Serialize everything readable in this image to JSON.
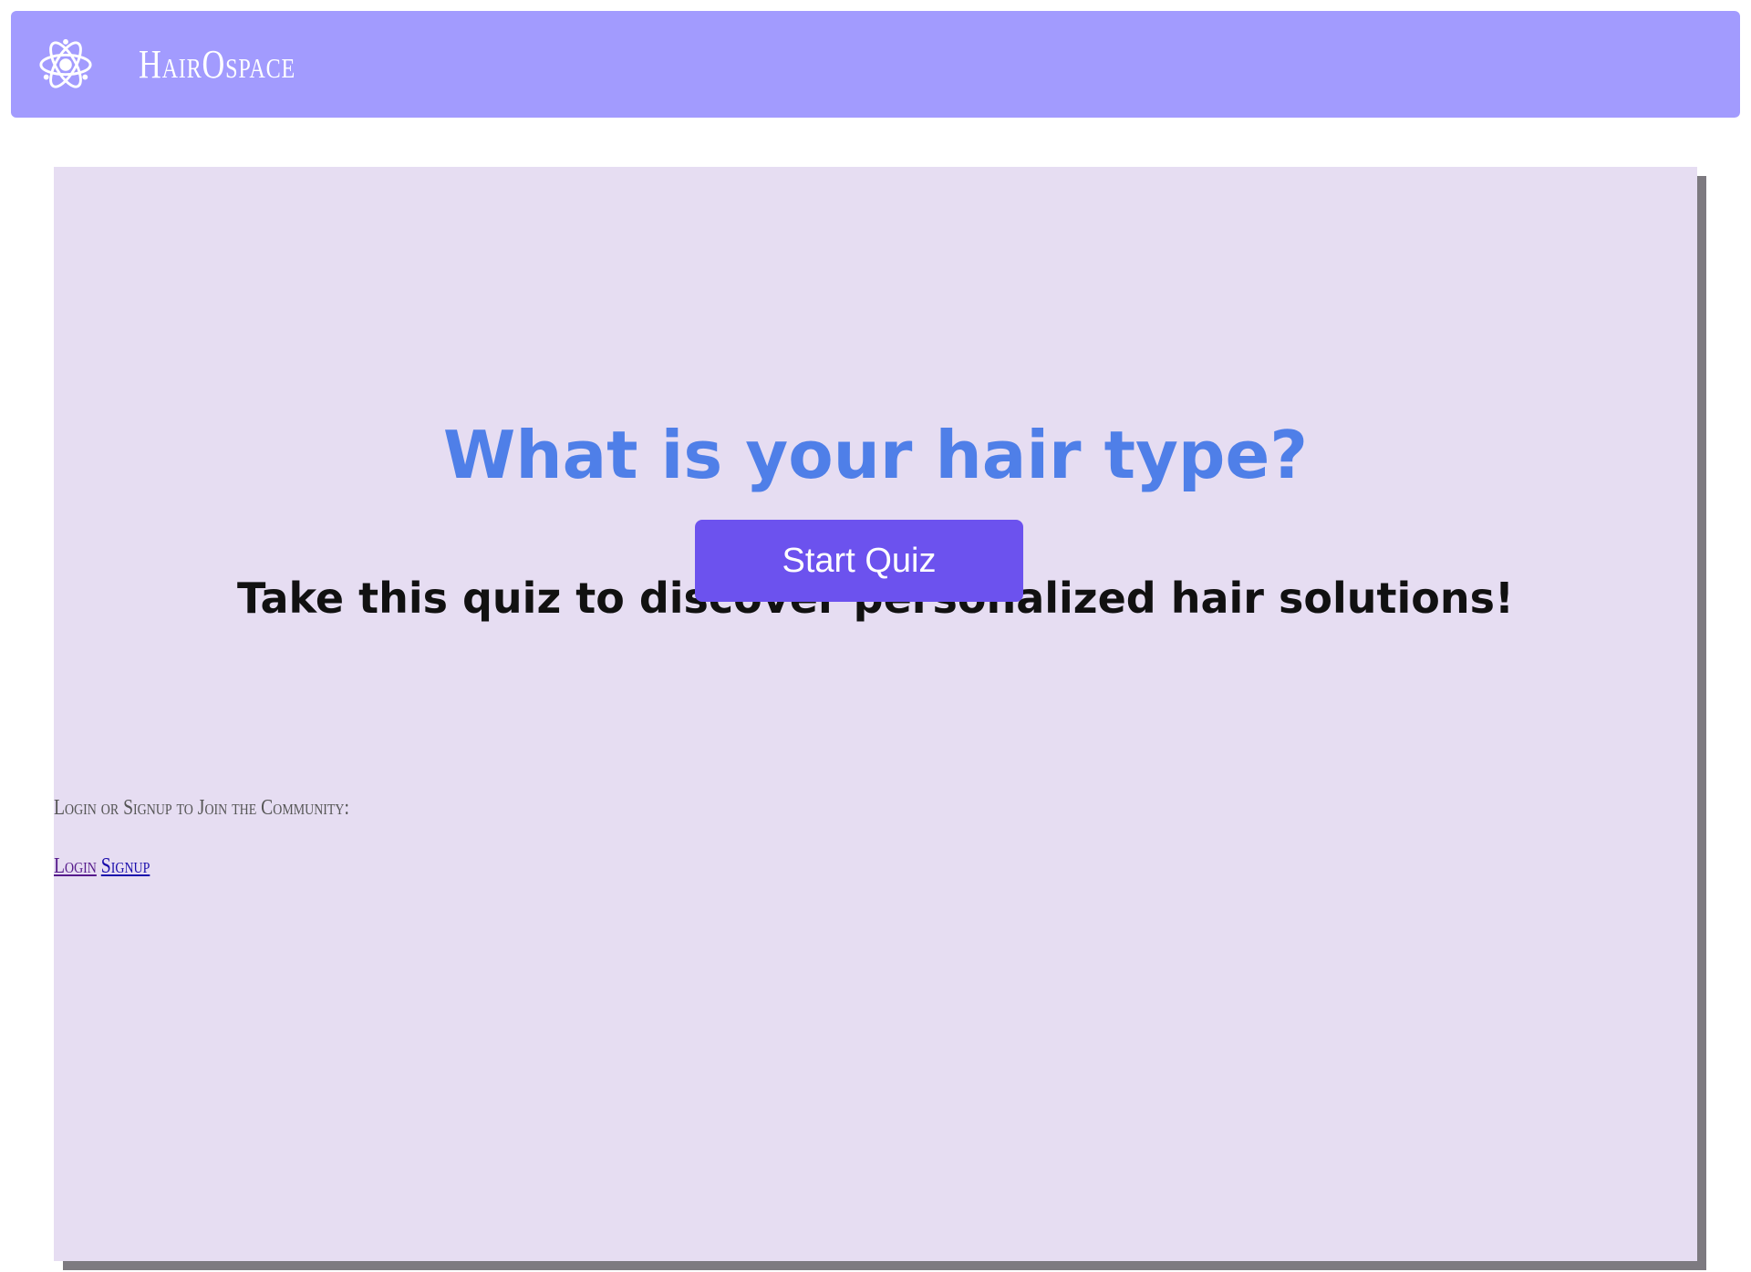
{
  "brand": {
    "name": "HairOspace",
    "logo_icon": "atom-icon"
  },
  "main": {
    "title": "What is your hair type?",
    "subtitle": "Take this quiz to discover personalized hair solutions!",
    "start_button": "Start Quiz",
    "community_text": "Login or Signup to Join the Community:",
    "login_link": "Login",
    "signup_link": "Signup"
  },
  "colors": {
    "navbar": "#a29bfe",
    "card_background": "#e6ddf2",
    "title": "#4f7fe8",
    "button": "#6c52ee"
  }
}
